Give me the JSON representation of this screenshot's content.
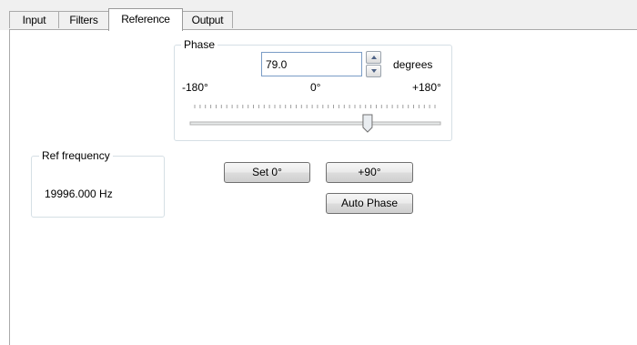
{
  "tabs": [
    {
      "label": "Input"
    },
    {
      "label": "Filters"
    },
    {
      "label": "Reference"
    },
    {
      "label": "Output"
    }
  ],
  "active_tab": "Reference",
  "phase_group": {
    "title": "Phase",
    "value": "79.0",
    "unit": "degrees",
    "scale_min": "-180°",
    "scale_mid": "0°",
    "scale_max": "+180°",
    "slider_min": -180,
    "slider_max": 180,
    "slider_value": 79.0
  },
  "ref_frequency_group": {
    "title": "Ref frequency",
    "value": "19996.000 Hz"
  },
  "buttons": {
    "set_zero": "Set 0°",
    "plus_ninety": "+90°",
    "auto_phase": "Auto Phase"
  }
}
